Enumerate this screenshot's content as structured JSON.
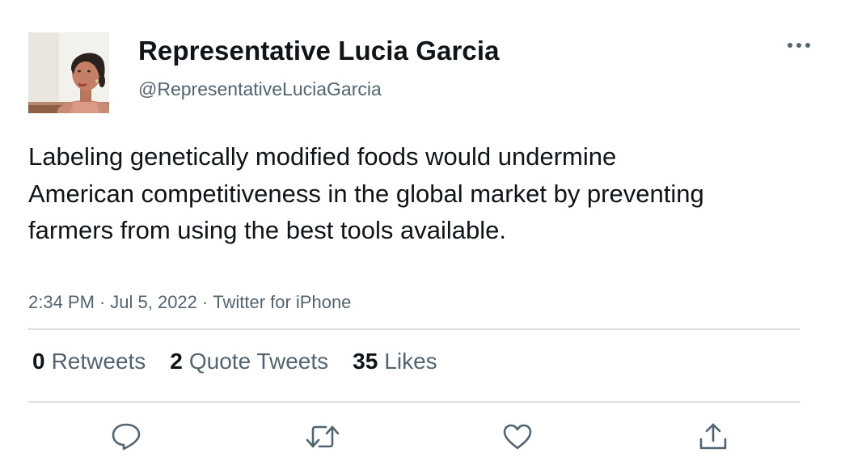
{
  "author": {
    "display_name": "Representative Lucia Garcia",
    "handle": "@RepresentativeLuciaGarcia",
    "avatar_icon": "profile-photo"
  },
  "tweet": {
    "text": "Labeling genetically modified foods would undermine American competitiveness in the global market by preventing farmers from using the best tools available.",
    "time": "2:34 PM",
    "date": "Jul 5, 2022",
    "source": "Twitter for iPhone",
    "separator": "·"
  },
  "stats": {
    "retweets_count": "0",
    "retweets_label": "Retweets",
    "quotes_count": "2",
    "quotes_label": "Quote Tweets",
    "likes_count": "35",
    "likes_label": "Likes"
  },
  "actions": {
    "reply_icon": "reply-icon",
    "retweet_icon": "retweet-icon",
    "like_icon": "heart-icon",
    "share_icon": "share-icon"
  },
  "colors": {
    "text_primary": "#0f1419",
    "text_secondary": "#536471",
    "divider": "#dcdfe2",
    "icon": "#536471"
  }
}
